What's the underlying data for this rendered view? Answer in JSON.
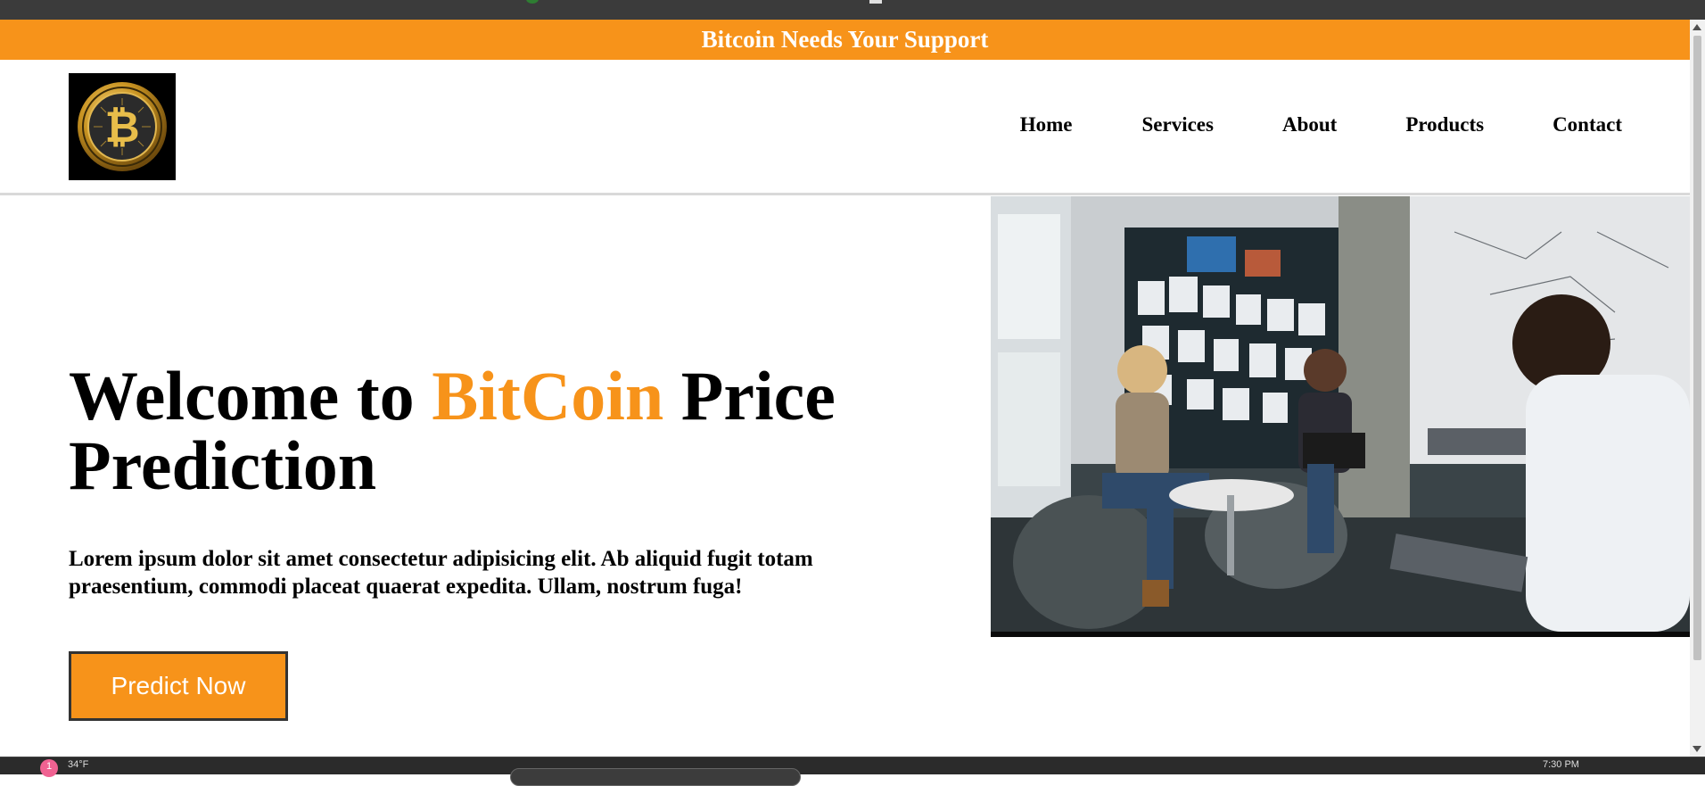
{
  "banner": {
    "text": "Bitcoin Needs Your Support"
  },
  "header": {
    "logo_alt": "bitcoin-logo",
    "nav": [
      {
        "label": "Home"
      },
      {
        "label": "Services"
      },
      {
        "label": "About"
      },
      {
        "label": "Products"
      },
      {
        "label": "Contact"
      }
    ]
  },
  "hero": {
    "title_prefix": "Welcome to ",
    "title_accent": "BitCoin",
    "title_suffix": " Price Prediction",
    "text": "Lorem ipsum dolor sit amet consectetur adipisicing elit. Ab aliquid fugit totam praesentium, commodi placeat quaerat expedita. Ullam, nostrum fuga!",
    "cta_label": "Predict Now",
    "image": "team-meeting-photo"
  },
  "taskbar": {
    "notification_count": "1",
    "weather": "34°F",
    "time": "7:30 PM"
  },
  "colors": {
    "accent": "#f7931a",
    "banner_text": "#ffffff",
    "text": "#000000"
  }
}
